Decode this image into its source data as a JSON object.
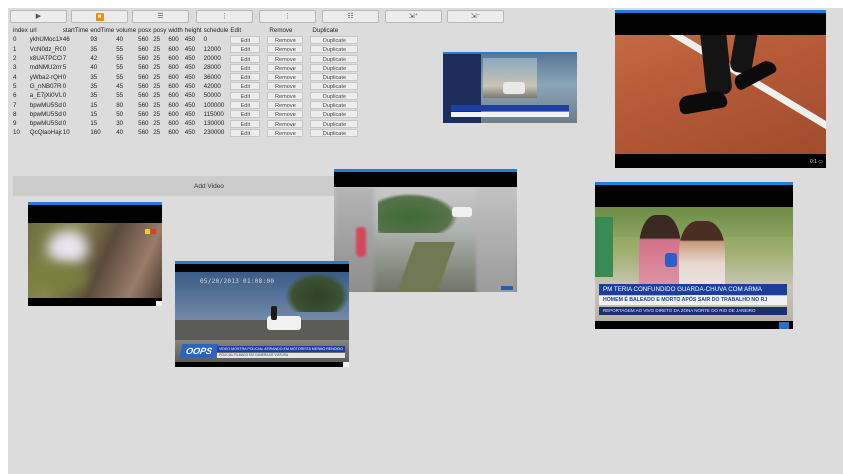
{
  "toolbar": {
    "buttons": [
      {
        "name": "play",
        "glyph": "▶"
      },
      {
        "name": "stop",
        "glyph": "■"
      },
      {
        "name": "layout-list",
        "glyph": "☰"
      },
      {
        "name": "step-back",
        "glyph": "⋮"
      },
      {
        "name": "step-forward",
        "glyph": "⋮"
      },
      {
        "name": "layout-grid",
        "glyph": "☷"
      },
      {
        "name": "zoom-in",
        "glyph": "⇲⁺"
      },
      {
        "name": "zoom-out",
        "glyph": "⇲⁻"
      }
    ]
  },
  "table": {
    "headers": [
      "index",
      "url",
      "startTime",
      "endTime",
      "volume",
      "posx",
      "posy",
      "width",
      "height",
      "schedule",
      "Edit",
      "Remove",
      "Duplicate"
    ],
    "edit_label": "Edit",
    "remove_label": "Remove",
    "duplicate_label": "Duplicate",
    "rows": [
      {
        "index": "0",
        "url": "ykhUMoc1Xw",
        "start": "46",
        "end": "93",
        "volume": "40",
        "posx": "560",
        "posy": "25",
        "width": "600",
        "height": "450",
        "schedule": "0"
      },
      {
        "index": "1",
        "url": "VcN0dz_RGUo",
        "start": "0",
        "end": "35",
        "volume": "55",
        "posx": "560",
        "posy": "25",
        "width": "600",
        "height": "450",
        "schedule": "12000"
      },
      {
        "index": "2",
        "url": "x8UATPCCkX0",
        "start": "7",
        "end": "42",
        "volume": "55",
        "posx": "560",
        "posy": "25",
        "width": "600",
        "height": "450",
        "schedule": "20000"
      },
      {
        "index": "3",
        "url": "mdNMU2rmTw",
        "start": "5",
        "end": "40",
        "volume": "55",
        "posx": "560",
        "posy": "25",
        "width": "600",
        "height": "450",
        "schedule": "28000"
      },
      {
        "index": "4",
        "url": "yWba2-rQHSo",
        "start": "0",
        "end": "35",
        "volume": "55",
        "posx": "560",
        "posy": "25",
        "width": "600",
        "height": "450",
        "schedule": "36000"
      },
      {
        "index": "5",
        "url": "G_nNB07Rog",
        "start": "0",
        "end": "35",
        "volume": "45",
        "posx": "560",
        "posy": "25",
        "width": "600",
        "height": "450",
        "schedule": "42000"
      },
      {
        "index": "6",
        "url": "a_E7jXi0VUo",
        "start": "0",
        "end": "35",
        "volume": "55",
        "posx": "560",
        "posy": "25",
        "width": "600",
        "height": "450",
        "schedule": "50000"
      },
      {
        "index": "7",
        "url": "bpwMU5SdPI",
        "start": "0",
        "end": "15",
        "volume": "80",
        "posx": "560",
        "posy": "25",
        "width": "600",
        "height": "450",
        "schedule": "100000"
      },
      {
        "index": "8",
        "url": "bpwMU5SdPI",
        "start": "0",
        "end": "15",
        "volume": "50",
        "posx": "560",
        "posy": "25",
        "width": "600",
        "height": "450",
        "schedule": "115000"
      },
      {
        "index": "9",
        "url": "bpwMU5SdPI",
        "start": "0",
        "end": "15",
        "volume": "30",
        "posx": "560",
        "posy": "25",
        "width": "600",
        "height": "450",
        "schedule": "130000"
      },
      {
        "index": "10",
        "url": "QcQlaoHajoM",
        "start": "10",
        "end": "160",
        "volume": "40",
        "posx": "560",
        "posy": "25",
        "width": "600",
        "height": "450",
        "schedule": "230000"
      }
    ]
  },
  "add_video_label": "Add Video",
  "tiles": {
    "shoes": {
      "counter": "0:1 ▭"
    },
    "dashcam": {
      "timestamp": "05/20/2013 01:08:00",
      "logo": "OOPS",
      "headline": "VÍDEO MOSTRA POLICIAL ATIRANDO EM MOTORISTA MESMO RENDIDO",
      "subline": "POLICIAL FILMADO EM CÂMERA DE VIATURA"
    },
    "news": {
      "headline": "PM TERIA CONFUNDIDO GUARDA-CHUVA COM ARMA",
      "subline": "HOMEM É BALEADO E MORTO APÓS SAIR DO TRABALHO NO RJ",
      "footer": "REPORTAGEM AO VIVO DIRETO DA ZONA NORTE DO RIO DE JANEIRO"
    }
  },
  "colors": {
    "accent": "#1f7fd6",
    "stage": "#dcdcdc",
    "play_active": "#f08a1c",
    "news_blue": "#1c3f9e"
  }
}
